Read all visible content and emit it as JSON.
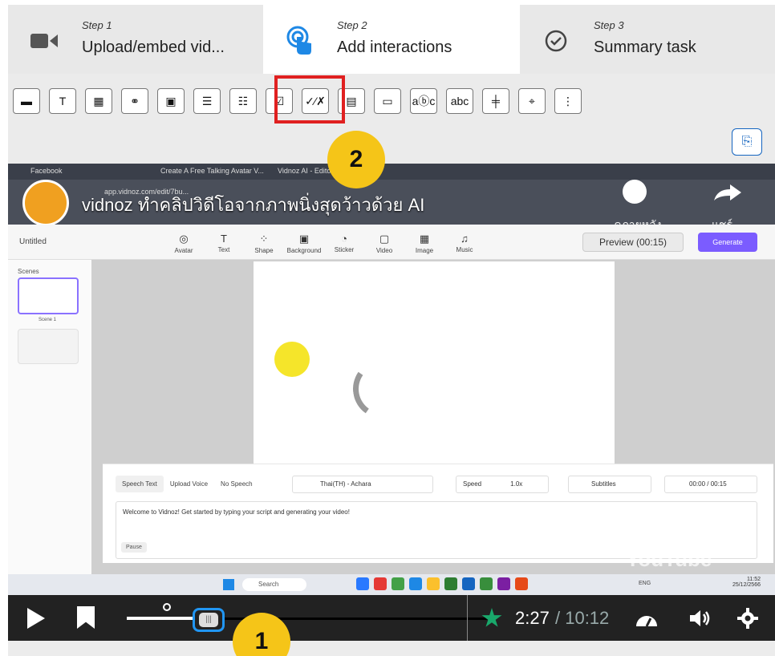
{
  "steps": [
    {
      "number": "Step 1",
      "label": "Upload/embed vid...",
      "icon": "video-camera-icon"
    },
    {
      "number": "Step 2",
      "label": "Add interactions",
      "icon": "touch-pointer-icon"
    },
    {
      "number": "Step 3",
      "label": "Summary task",
      "icon": "check-circle-icon"
    }
  ],
  "toolbar": {
    "tools": [
      {
        "name": "label-tool",
        "glyph": "▬"
      },
      {
        "name": "text-tool",
        "glyph": "T"
      },
      {
        "name": "table-tool",
        "glyph": "▦"
      },
      {
        "name": "link-tool",
        "glyph": "⚭"
      },
      {
        "name": "image-tool",
        "glyph": "▣"
      },
      {
        "name": "statements-tool",
        "glyph": "☰"
      },
      {
        "name": "single-choice-tool",
        "glyph": "☷"
      },
      {
        "name": "multiple-choice-tool",
        "glyph": "☑"
      },
      {
        "name": "true-false-tool",
        "glyph": "✓⁄✗"
      },
      {
        "name": "drag-drop-tool",
        "glyph": "▤"
      },
      {
        "name": "mark-words-tool",
        "glyph": "▭"
      },
      {
        "name": "drag-text-tool",
        "glyph": "aⓑc"
      },
      {
        "name": "fill-blanks-tool",
        "glyph": "abc"
      },
      {
        "name": "crossroads-tool",
        "glyph": "╪"
      },
      {
        "name": "navigation-hotspot-tool",
        "glyph": "⌖"
      },
      {
        "name": "more-tool",
        "glyph": "⋮"
      }
    ]
  },
  "badges": {
    "top": "2",
    "bottom": "1"
  },
  "video": {
    "title": "vidnoz ทำคลิปวิดีโอจากภาพนิ่งสุดว้าวด้วย AI",
    "watch_later": "ดูภายหลัง",
    "share": "แชร์",
    "browser_tabs": [
      "Facebook",
      "Create A Free Talking Avatar V...",
      "Vidnoz AI - Editor"
    ],
    "address": "app.vidnoz.com/edit/7bu...",
    "untitled": "Untitled",
    "tools": [
      "Avatar",
      "Text",
      "Shape",
      "Background",
      "Sticker",
      "Video",
      "Image",
      "Music"
    ],
    "preview": "Preview (00:15)",
    "generate": "Generate",
    "scenes_label": "Scenes",
    "scene1": "Scene 1",
    "panel_tabs": [
      "Speech Text",
      "Upload Voice",
      "No Speech"
    ],
    "voice": "Thai(TH) - Achara",
    "speed_label": "Speed",
    "speed_value": "1.0x",
    "subtitles": "Subtitles",
    "play_time": "00:00 / 00:15",
    "script_text": "Welcome to Vidnoz! Get started by typing your script and generating your video!",
    "pause": "Pause",
    "youtube": "YouTube",
    "search": "Search",
    "lang": "ENG",
    "clock_time": "11:52",
    "clock_date": "25/12/2566"
  },
  "player": {
    "current_time": "2:27",
    "duration": "/ 10:12",
    "progress": 0.24
  }
}
